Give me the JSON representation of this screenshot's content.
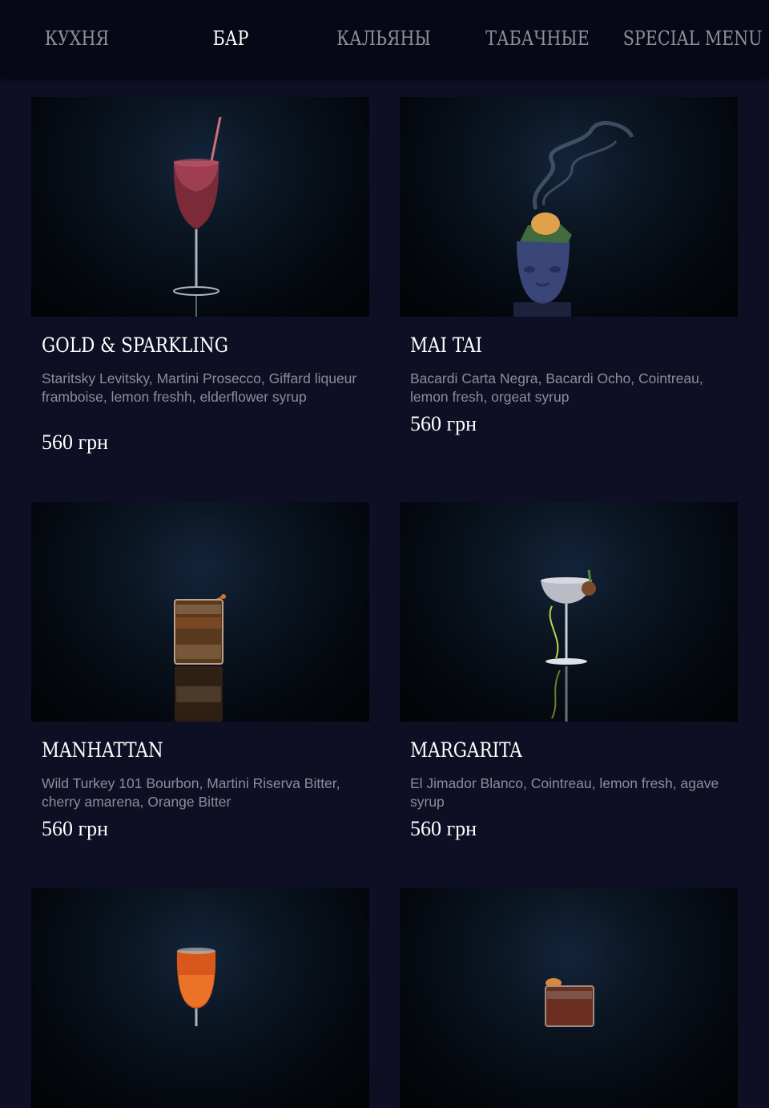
{
  "nav": {
    "tabs": [
      {
        "label": "КУХНЯ",
        "active": false
      },
      {
        "label": "БАР",
        "active": true
      },
      {
        "label": "КАЛЬЯНЫ",
        "active": false
      },
      {
        "label": "ТАБАЧНЫЕ",
        "active": false
      },
      {
        "label": "SPECIAL MENU",
        "active": false
      }
    ]
  },
  "items": [
    {
      "title": "GOLD & SPARKLING",
      "description": "Staritsky Levitsky, Martini Prosecco, Giffard liqueur framboise, lemon freshh, elderflower syrup",
      "price": "560 грн"
    },
    {
      "title": "MAI TAI",
      "description": "Bacardi Carta Negra, Bacardi Ocho, Cointreau, lemon fresh, orgeat syrup",
      "price": "560 грн"
    },
    {
      "title": "MANHATTAN",
      "description": "Wild Turkey 101 Bourbon, Martini Riserva Bitter, cherry amarena, Orange Bitter",
      "price": "560 грн"
    },
    {
      "title": "MARGARITA",
      "description": "El Jimador Blanco, Cointreau, lemon fresh, agave syrup",
      "price": "560 грн"
    },
    {
      "title": "",
      "description": "",
      "price": ""
    },
    {
      "title": "",
      "description": "",
      "price": ""
    }
  ],
  "colors": {
    "background": "#0e0f24",
    "nav_background": "#070815",
    "active_tab": "#ffffff",
    "inactive_tab": "#8d8f98",
    "description": "#8c8d98"
  }
}
